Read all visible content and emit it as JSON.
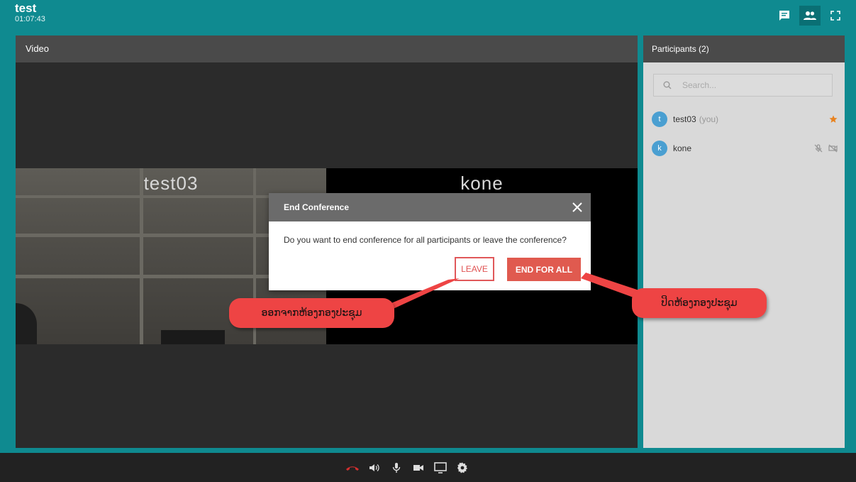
{
  "app": {
    "title": "test",
    "elapsed": "01:07:43"
  },
  "top_icons": [
    {
      "name": "chat-icon",
      "active": false
    },
    {
      "name": "participants-icon",
      "active": true
    },
    {
      "name": "fullscreen-icon",
      "active": false
    }
  ],
  "video": {
    "header": "Video",
    "tiles": [
      {
        "name": "test03"
      },
      {
        "name": "kone"
      }
    ]
  },
  "participants": {
    "header": "Participants (2)",
    "search_placeholder": "Search...",
    "list": [
      {
        "initial": "t",
        "name": "test03",
        "suffix": "(you)"
      },
      {
        "initial": "k",
        "name": "kone"
      }
    ]
  },
  "modal": {
    "title": "End Conference",
    "message": "Do you want to end conference for all participants or leave the conference?",
    "leave_label": "LEAVE",
    "end_label": "END FOR ALL"
  },
  "callouts": {
    "leave": "ອອກຈາກຫ້ອງກອງປະຊຸມ",
    "end": "ປິດຫ້ອງກອງປະຊຸມ"
  },
  "controls": [
    "hangup-icon",
    "speaker-icon",
    "microphone-icon",
    "camera-icon",
    "screen-share-icon",
    "settings-icon"
  ],
  "colors": {
    "teal": "#0f8a90",
    "accent_red": "#e05a4f",
    "avatar_blue": "#4a9fd1",
    "star": "#e8821f"
  }
}
